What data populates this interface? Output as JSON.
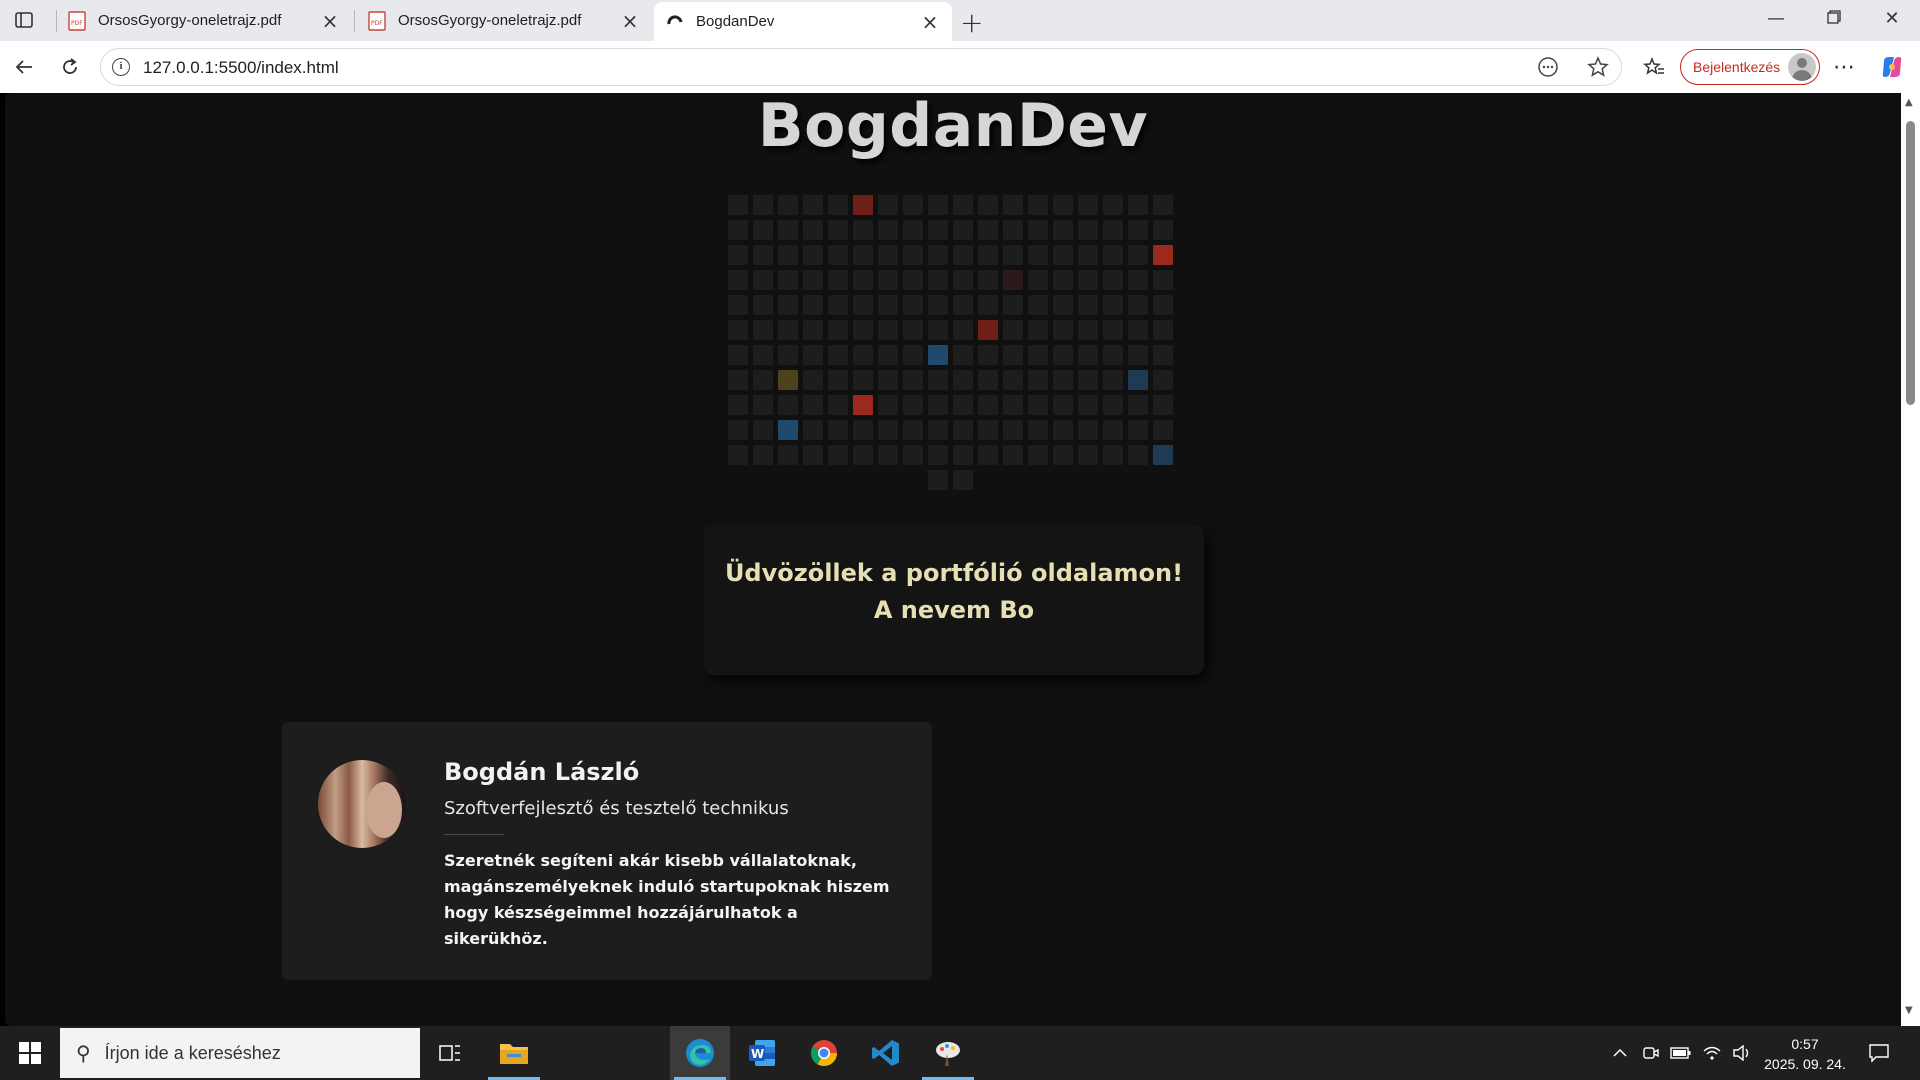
{
  "browser": {
    "tabs": [
      {
        "title": "OrsosGyorgy-oneletrajz.pdf",
        "icon": "pdf-icon",
        "active": false
      },
      {
        "title": "OrsosGyorgy-oneletrajz.pdf",
        "icon": "pdf-icon",
        "active": false
      },
      {
        "title": "BogdanDev",
        "icon": "site-icon",
        "active": true
      }
    ],
    "url": "127.0.0.1:5500/index.html",
    "signin_label": "Bejelentkezés"
  },
  "page": {
    "brand": "BogdanDev",
    "welcome_line1": "Üdvözöllek a portfólió oldalamon!",
    "welcome_line2": "A nevem Bo",
    "profile": {
      "name": "Bogdán László",
      "role": "Szoftverfejlesztő és tesztelő technikus",
      "bio": "Szeretnék segíteni akár kisebb vállalatoknak, magánszemélyeknek induló startupoknak hiszem hogy készségeimmel hozzájárulhatok a sikerükhöz."
    },
    "grid": {
      "rows": 11,
      "cols": 18,
      "last_row_extra": 2,
      "highlighted": [
        {
          "r": 0,
          "c": 5,
          "color": "red"
        },
        {
          "r": 2,
          "c": 17,
          "color": "red2"
        },
        {
          "r": 3,
          "c": 11,
          "color": "dim"
        },
        {
          "r": 5,
          "c": 10,
          "color": "red"
        },
        {
          "r": 6,
          "c": 8,
          "color": "blue"
        },
        {
          "r": 7,
          "c": 2,
          "color": "yellow"
        },
        {
          "r": 7,
          "c": 16,
          "color": "blue2"
        },
        {
          "r": 8,
          "c": 5,
          "color": "red2"
        },
        {
          "r": 9,
          "c": 2,
          "color": "blue"
        },
        {
          "r": 10,
          "c": 17,
          "color": "blue2"
        }
      ]
    }
  },
  "taskbar": {
    "search_placeholder": "Írjon ide a kereséshez",
    "time": "0:57",
    "date": "2025. 09. 24."
  }
}
